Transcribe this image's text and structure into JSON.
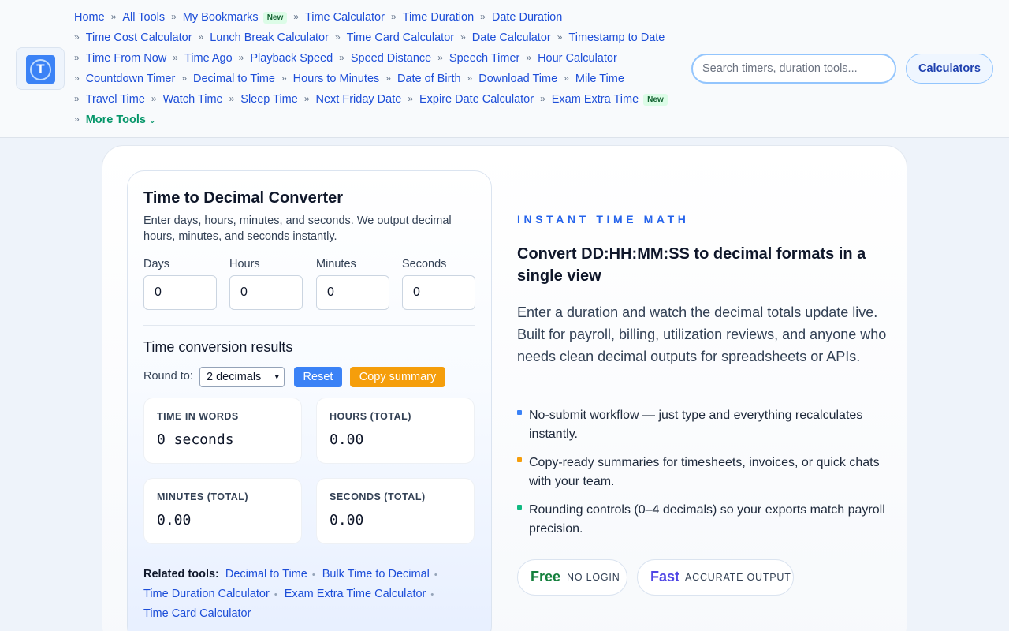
{
  "header": {
    "logo_icon": "clock-t-logo-icon",
    "crumbs": [
      [
        {
          "label": "Home"
        },
        {
          "label": "All Tools"
        },
        {
          "label": "My Bookmarks",
          "badge": "New"
        },
        {
          "label": "Time Calculator"
        },
        {
          "label": "Time Duration"
        },
        {
          "label": "Date Duration"
        }
      ],
      [
        {
          "label": "Time Cost Calculator"
        },
        {
          "label": "Lunch Break Calculator"
        },
        {
          "label": "Time Card Calculator"
        },
        {
          "label": "Date Calculator"
        },
        {
          "label": "Timestamp to Date"
        }
      ],
      [
        {
          "label": "Time From Now"
        },
        {
          "label": "Time Ago"
        },
        {
          "label": "Playback Speed"
        },
        {
          "label": "Speed Distance"
        },
        {
          "label": "Speech Timer"
        },
        {
          "label": "Hour Calculator"
        }
      ],
      [
        {
          "label": "Countdown Timer"
        },
        {
          "label": "Decimal to Time"
        },
        {
          "label": "Hours to Minutes"
        },
        {
          "label": "Date of Birth"
        },
        {
          "label": "Download Time"
        },
        {
          "label": "Mile Time"
        }
      ],
      [
        {
          "label": "Travel Time"
        },
        {
          "label": "Watch Time"
        },
        {
          "label": "Sleep Time"
        },
        {
          "label": "Next Friday Date"
        },
        {
          "label": "Expire Date Calculator"
        },
        {
          "label": "Exam Extra Time",
          "badge": "New"
        }
      ]
    ],
    "more_tools": "More Tools",
    "separator": "»",
    "search_placeholder": "Search timers, duration tools...",
    "calculators_button": "Calculators"
  },
  "converter": {
    "title": "Time to Decimal Converter",
    "description": "Enter days, hours, minutes, and seconds. We output decimal hours, minutes, and seconds instantly.",
    "fields": {
      "days": {
        "label": "Days",
        "value": "0"
      },
      "hours": {
        "label": "Hours",
        "value": "0"
      },
      "minutes": {
        "label": "Minutes",
        "value": "0"
      },
      "seconds": {
        "label": "Seconds",
        "value": "0"
      }
    },
    "results_title": "Time conversion results",
    "round_label": "Round to:",
    "round_value": "2 decimals",
    "reset_label": "Reset",
    "copy_label": "Copy summary",
    "results": {
      "words": {
        "label": "TIME IN WORDS",
        "value": "0 seconds"
      },
      "hours": {
        "label": "HOURS (TOTAL)",
        "value": "0.00"
      },
      "minutes": {
        "label": "MINUTES (TOTAL)",
        "value": "0.00"
      },
      "seconds": {
        "label": "SECONDS (TOTAL)",
        "value": "0.00"
      }
    },
    "related_label": "Related tools:",
    "related_links": [
      "Decimal to Time",
      "Bulk Time to Decimal",
      "Time Duration Calculator",
      "Exam Extra Time Calculator",
      "Time Card Calculator"
    ]
  },
  "info": {
    "kicker": "INSTANT TIME MATH",
    "headline": "Convert DD:HH:MM:SS to decimal formats in a single view",
    "intro": "Enter a duration and watch the decimal totals update live. Built for payroll, billing, utilization reviews, and anyone who needs clean decimal outputs for spreadsheets or APIs.",
    "bullets": [
      {
        "text": "No-submit workflow — just type and everything recalculates instantly.",
        "color": "#3b82f6"
      },
      {
        "text": "Copy-ready summaries for timesheets, invoices, or quick chats with your team.",
        "color": "#f59e0b"
      },
      {
        "text": "Rounding controls (0–4 decimals) so your exports match payroll precision.",
        "color": "#10b981"
      }
    ],
    "pills": {
      "free": {
        "big": "Free",
        "small": "NO LOGIN",
        "color": "#15803d"
      },
      "fast": {
        "big": "Fast",
        "small": "ACCURATE OUTPUT",
        "color": "#4f46e5"
      }
    }
  }
}
